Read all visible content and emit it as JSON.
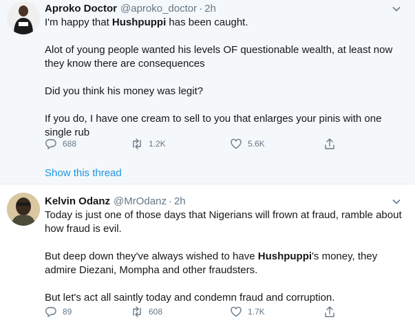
{
  "tweets": [
    {
      "name": "Aproko Doctor",
      "handle": "@aproko_doctor",
      "separator": "·",
      "time": "2h",
      "paragraphs": {
        "p1_pre": "I'm happy that ",
        "p1_bold": "Hushpuppi",
        "p1_post": " has been caught.",
        "p2": "Alot of young people wanted his levels OF questionable wealth, at least now they know there are consequences",
        "p3": "Did you think his money was legit?",
        "p4": "If you do, I have one cream to sell to you that enlarges your pinis with one single rub"
      },
      "replies": "688",
      "retweets": "1.2K",
      "likes": "5.6K"
    },
    {
      "name": "Kelvin Odanz",
      "handle": "@MrOdanz",
      "separator": "·",
      "time": "2h",
      "paragraphs": {
        "p1": "Today is just one of those days that Nigerians will frown at fraud, ramble about how fraud is evil.",
        "p2_pre": "But deep down they've always wished to have ",
        "p2_bold": "Hushpuppi",
        "p2_post": "'s money, they admire Diezani, Mompha and other fraudsters.",
        "p3": "But let's act all saintly today and condemn fraud and corruption."
      },
      "replies": "89",
      "retweets": "608",
      "likes": "1.7K"
    }
  ],
  "thread": {
    "show_label": "Show this thread"
  },
  "icons": {
    "reply": "reply-icon",
    "retweet": "retweet-icon",
    "like": "heart-icon",
    "share": "share-icon",
    "caret": "chevron-down-icon"
  },
  "colors": {
    "link": "#1b95e0",
    "muted": "#657786",
    "text": "#14171a",
    "highlight_bg": "#f5f8fa"
  }
}
